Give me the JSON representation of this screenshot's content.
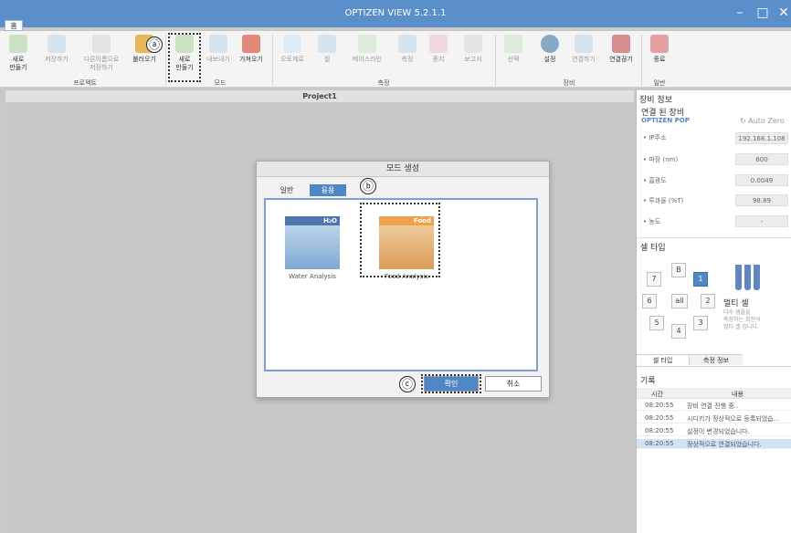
{
  "window": {
    "title": "OPTIZEN VIEW 5.2.1.1",
    "home_tab": "홈"
  },
  "ribbon": {
    "buttons": {
      "new": "새로\n만들기",
      "save": "저장하기",
      "save_as": "다른이름으로\n저장하기",
      "open": "불러오기",
      "mode_new": "새로\n만들기",
      "export": "내보내기",
      "import": "가져오기",
      "autozero": "오토제로",
      "cell": "셀",
      "baseline": "베이스라인",
      "measure": "측정",
      "stop": "중지",
      "report": "보고서",
      "select": "선택",
      "settings": "설정",
      "connect": "연결하기",
      "disconnect": "연결끊기",
      "exit": "종료"
    },
    "groups": {
      "project": "프로젝트",
      "mode": "모드",
      "measure": "측정",
      "device": "장비",
      "general": "일반"
    }
  },
  "annotations": {
    "a": "ⓐ",
    "b": "ⓑ",
    "c": "ⓒ"
  },
  "project": {
    "title": "Project1"
  },
  "device_info": {
    "header": "장비 정보",
    "connected_label": "연결 된 장비",
    "device_name": "OPTIZEN POP",
    "auto_zero": "Auto Zero",
    "rows": [
      {
        "label": "• IP주소",
        "value": "192.168.1.108"
      },
      {
        "label": "• 파장 (nm)",
        "value": "600"
      },
      {
        "label": "• 흡광도",
        "value": "0.0049"
      },
      {
        "label": "• 투과율 (%T)",
        "value": "98.89"
      },
      {
        "label": "• 농도",
        "value": "-"
      }
    ]
  },
  "cell_type": {
    "header": "셀 타입",
    "buttons": [
      "7",
      "B",
      "1",
      "6",
      "all",
      "2",
      "5",
      "4",
      "3"
    ],
    "multi_title": "멀티 셀",
    "multi_desc": "다수 샘플을\n측정하는 회전식\n멀티 셀 입니다.",
    "tabs": [
      "셀 타입",
      "측정 정보"
    ]
  },
  "log": {
    "header": "기록",
    "col_time": "시간",
    "col_content": "내용",
    "rows": [
      {
        "time": "08:20:55",
        "text": "장비 연결 진행 중.."
      },
      {
        "time": "08:20:55",
        "text": "시디키가 정상적으로 등록되었습..."
      },
      {
        "time": "08:20:55",
        "text": "설정이 변경되었습니다."
      },
      {
        "time": "08:20:55",
        "text": "정상적으로 연결되었습니다."
      }
    ]
  },
  "dialog": {
    "title": "모드 생성",
    "tab_general": "일반",
    "tab_application": "응용",
    "cards": [
      {
        "badge": "H₂O",
        "label": "Water Analysis"
      },
      {
        "badge": "Food",
        "label": "Food Analysis"
      }
    ],
    "ok": "확인",
    "cancel": "취소"
  },
  "colors": {
    "accent": "#5b8fc9",
    "selected": "#4f86c6"
  }
}
